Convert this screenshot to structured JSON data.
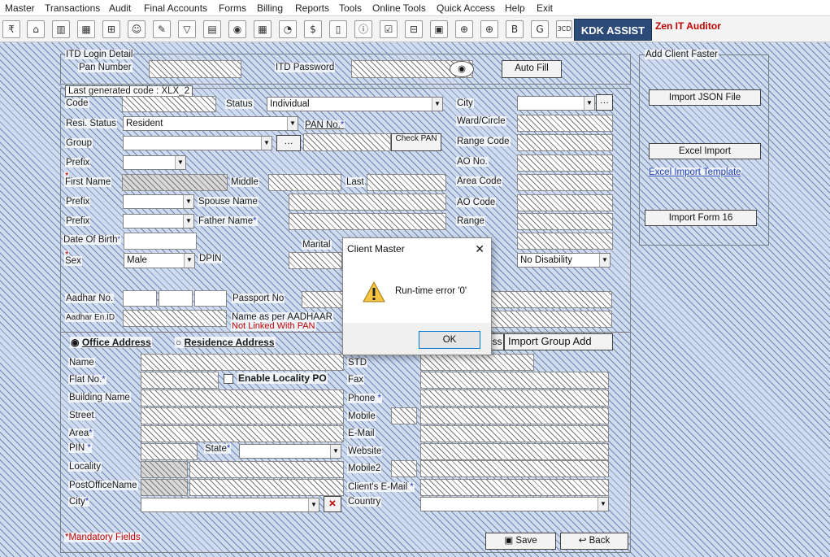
{
  "menu": [
    "Master",
    "Transactions",
    "Audit",
    "Final Accounts",
    "Forms",
    "Billing",
    "Reports",
    "Tools",
    "Online Tools",
    "Quick Access",
    "Help",
    "Exit"
  ],
  "toolbar": {
    "kdk_label": "KDK ASSIST",
    "zen_label": "Zen IT Auditor",
    "icons": [
      "rupee-icon",
      "home-icon",
      "chart-icon",
      "calculator-icon",
      "gift-icon",
      "users-icon",
      "pin-icon",
      "filter-icon",
      "tax-icon",
      "refresh-icon",
      "calc-icon",
      "pie-icon",
      "pay-icon",
      "book-icon",
      "info-icon",
      "checklist-icon",
      "grid-icon",
      "calendar-icon",
      "add-icon",
      "add2-icon",
      "bs-icon",
      "bsg-icon",
      "3cd-icon"
    ]
  },
  "itd": {
    "legend": "ITD Login Detail",
    "pan_label": "Pan Number",
    "password_label": "ITD Password",
    "autofill": "Auto Fill"
  },
  "addclient": {
    "legend": "Add Client Faster",
    "import_json": "Import JSON File",
    "excel_import": "Excel Import",
    "excel_template": "Excel Import Template",
    "import_form16": "Import Form 16"
  },
  "form": {
    "last_code": "Last generated code : XLX_2",
    "code": "Code",
    "status": "Status",
    "status_value": "Individual",
    "city": "City",
    "resi_status": "Resi. Status",
    "resi_value": "Resident",
    "pan_no": "PAN No.",
    "ward": "Ward/Circle",
    "group": "Group",
    "check_pan": "Check PAN",
    "range_code": "Range Code",
    "prefix": "Prefix",
    "ao_no": "AO No.",
    "first_name": "First Name",
    "middle": "Middle",
    "last": "Last",
    "area_code": "Area Code",
    "spouse": "Spouse Name",
    "ao_code": "AO Code",
    "father": "Father Name",
    "range": "Range",
    "dob": "Date Of Birth",
    "marital": "Marital",
    "sex": "Sex",
    "sex_value": "Male",
    "dpin": "DPIN",
    "disability_value": "No Disability",
    "aadhar": "Aadhar No.",
    "passport": "Passport No",
    "aadhar_en": "Aadhar En.ID",
    "name_aadhaar": "Name as per AADHAAR",
    "not_linked": "Not Linked With PAN",
    "office": "Office Address",
    "residence": "Residence Address",
    "import_group": "Import Group Add",
    "name": "Name",
    "std": "STD",
    "flat": "Flat No.",
    "enable_locality": "Enable Locality PO",
    "fax": "Fax",
    "building": "Building Name",
    "phone": "Phone",
    "street": "Street",
    "mobile": "Mobile",
    "area": "Area",
    "email": "E-Mail",
    "pin": "PIN",
    "state": "State",
    "website": "Website",
    "locality": "Locality",
    "mobile2": "Mobile2",
    "postoffice": "PostOfficeName",
    "client_email": "Client's E-Mail",
    "city2": "City",
    "country": "Country",
    "mandatory": "*Mandatory Fields",
    "save": "Save",
    "back": "Back"
  },
  "dialog": {
    "title": "Client Master",
    "message": "Run-time error '0'",
    "ok": "OK",
    "close": "✕"
  }
}
